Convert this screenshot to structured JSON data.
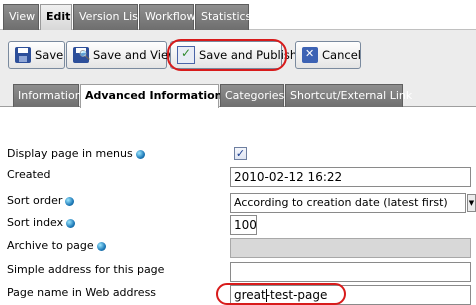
{
  "top_tabs": [
    "View",
    "Edit",
    "Version List",
    "Workflow",
    "Statistics"
  ],
  "toolbar": {
    "save": "Save",
    "save_view": "Save and View",
    "save_publish": "Save and Publish",
    "cancel": "Cancel"
  },
  "sub_tabs": [
    "Information",
    "Advanced Information",
    "Categories",
    "Shortcut/External Link"
  ],
  "form": {
    "display_in_menus": {
      "label": "Display page in menus",
      "checked": true,
      "check": "✓"
    },
    "created": {
      "label": "Created",
      "value": "2010-02-12 16:22"
    },
    "sort_order": {
      "label": "Sort order",
      "value": "According to creation date (latest first)"
    },
    "sort_index": {
      "label": "Sort index",
      "value": "100"
    },
    "archive": {
      "label": "Archive to page",
      "value": ""
    },
    "simple_address": {
      "label": "Simple address for this page",
      "value": ""
    },
    "page_name": {
      "label": "Page name in Web address",
      "value": "great-test-page"
    }
  },
  "colors": {
    "highlight": "#d81b1b",
    "tab_dark": "#7a7a7a"
  },
  "icons": {
    "info": "globe-icon",
    "save": "floppy-icon",
    "cancel": "cancel-icon"
  }
}
